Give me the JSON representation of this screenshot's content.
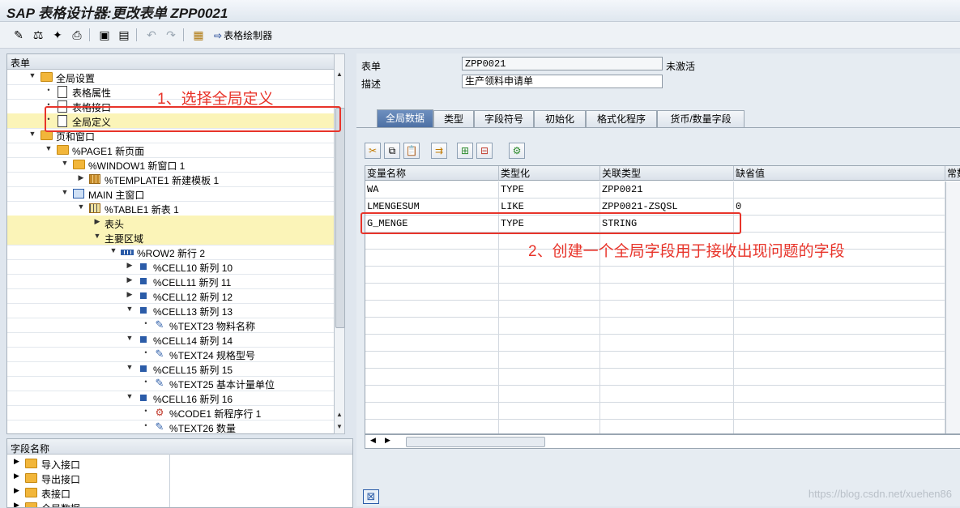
{
  "window": {
    "title": "SAP 表格设计器:更改表单 ZPP0021"
  },
  "toolbar": {
    "drawer_label": "表格绘制器"
  },
  "tree": {
    "header": "表单",
    "rows": [
      {
        "label": "全局设置",
        "depth": 1,
        "tog": "▼",
        "icon": "folder"
      },
      {
        "label": "表格属性",
        "depth": 2,
        "tog": "•",
        "icon": "doc"
      },
      {
        "label": "表格接口",
        "depth": 2,
        "tog": "•",
        "icon": "doc"
      },
      {
        "label": "全局定义",
        "depth": 2,
        "tog": "•",
        "icon": "doc",
        "hl": true
      },
      {
        "label": "页和窗口",
        "depth": 1,
        "tog": "▼",
        "icon": "folder"
      },
      {
        "label": "%PAGE1 新页面",
        "depth": 2,
        "tog": "▼",
        "icon": "folder"
      },
      {
        "label": "%WINDOW1 新窗口 1",
        "depth": 3,
        "tog": "▼",
        "icon": "folder"
      },
      {
        "label": "%TEMPLATE1 新建模板 1",
        "depth": 4,
        "tog": "▶",
        "icon": "grid"
      },
      {
        "label": "MAIN 主窗口",
        "depth": 3,
        "tog": "▼",
        "icon": "win"
      },
      {
        "label": "%TABLE1 新表 1",
        "depth": 4,
        "tog": "▼",
        "icon": "table"
      },
      {
        "label": "表头",
        "depth": 5,
        "tog": "▶",
        "icon": "none",
        "hl": true
      },
      {
        "label": "主要区域",
        "depth": 5,
        "tog": "▼",
        "icon": "none",
        "hl": true
      },
      {
        "label": "%ROW2 新行 2",
        "depth": 6,
        "tog": "▼",
        "icon": "row"
      },
      {
        "label": "%CELL10 新列 10",
        "depth": 7,
        "tog": "▶",
        "icon": "cell"
      },
      {
        "label": "%CELL11 新列 11",
        "depth": 7,
        "tog": "▶",
        "icon": "cell"
      },
      {
        "label": "%CELL12 新列 12",
        "depth": 7,
        "tog": "▶",
        "icon": "cell"
      },
      {
        "label": "%CELL13 新列 13",
        "depth": 7,
        "tog": "▼",
        "icon": "cell"
      },
      {
        "label": "%TEXT23 物料名称",
        "depth": 8,
        "tog": "•",
        "icon": "text"
      },
      {
        "label": "%CELL14 新列 14",
        "depth": 7,
        "tog": "▼",
        "icon": "cell"
      },
      {
        "label": "%TEXT24 规格型号",
        "depth": 8,
        "tog": "•",
        "icon": "text"
      },
      {
        "label": "%CELL15 新列 15",
        "depth": 7,
        "tog": "▼",
        "icon": "cell"
      },
      {
        "label": "%TEXT25 基本计量单位",
        "depth": 8,
        "tog": "•",
        "icon": "text"
      },
      {
        "label": "%CELL16 新列 16",
        "depth": 7,
        "tog": "▼",
        "icon": "cell"
      },
      {
        "label": "%CODE1 新程序行 1",
        "depth": 8,
        "tog": "•",
        "icon": "code"
      },
      {
        "label": "%TEXT26 数量",
        "depth": 8,
        "tog": "•",
        "icon": "text"
      }
    ]
  },
  "fields": {
    "header": "字段名称",
    "items": [
      "导入接口",
      "导出接口",
      "表接口",
      "全局数据"
    ]
  },
  "form": {
    "form_label": "表单",
    "form_value": "ZPP0021",
    "status": "未激活",
    "desc_label": "描述",
    "desc_value": "生产领料申请单"
  },
  "tabs": [
    "全局数据",
    "类型",
    "字段符号",
    "初始化",
    "格式化程序",
    "货币/数量字段"
  ],
  "grid": {
    "columns": [
      "变量名称",
      "类型化",
      "关联类型",
      "缺省值",
      "常数"
    ],
    "rows": [
      [
        "WA",
        "TYPE",
        "ZPP0021",
        ""
      ],
      [
        "LMENGESUM",
        "LIKE",
        "ZPP0021-ZSQSL",
        "0"
      ],
      [
        "G_MENGE",
        "TYPE",
        "STRING",
        ""
      ]
    ]
  },
  "annotations": {
    "step1": "1、选择全局定义",
    "step2": "2、创建一个全局字段用于接收出现问题的字段"
  },
  "watermark": "https://blog.csdn.net/xuehen86",
  "colors": {
    "annotation": "#e8342a",
    "highlight": "#fbf4b8",
    "tab_active": "#4c6fa3"
  }
}
